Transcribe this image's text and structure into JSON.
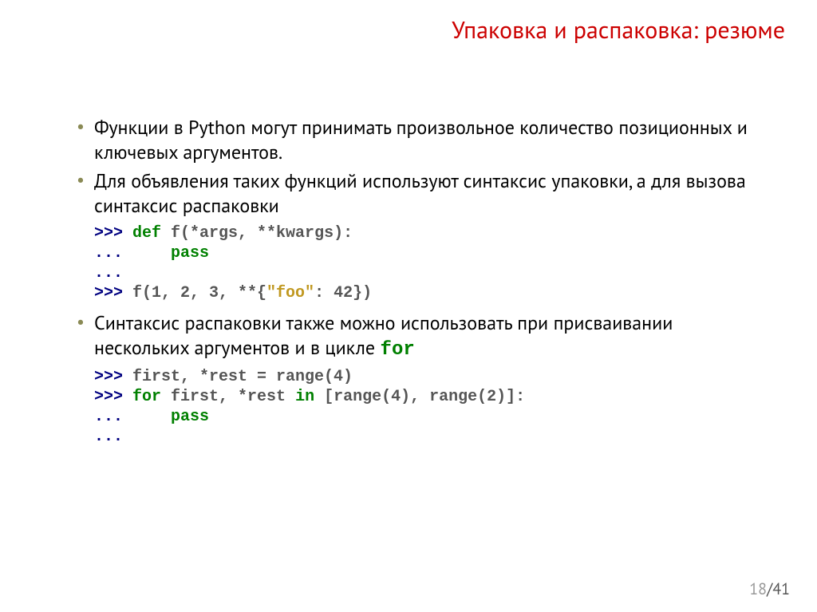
{
  "title": "Упаковка и распаковка: резюме",
  "bullets": {
    "b1": "Функции в Python могут принимать произвольное количество позиционных и ключевых аргументов.",
    "b2": "Для объявления таких функций используют синтаксис упаковки, а для вызова синтаксис распаковки",
    "b3_prefix": "Синтаксис распаковки также можно использовать при присваивании нескольких аргументов и в цикле ",
    "b3_code": "for"
  },
  "code1": {
    "l1_prompt": ">>> ",
    "l1_def": "def",
    "l1_rest": " f(*args, **kwargs):",
    "l2_prompt": "... ",
    "l2_indent": "    ",
    "l2_pass": "pass",
    "l3_prompt": "...",
    "l4_prompt": ">>> ",
    "l4_call_a": "f(1, 2, 3, **{",
    "l4_str": "\"foo\"",
    "l4_call_b": ": 42})"
  },
  "code2": {
    "l1_prompt": ">>> ",
    "l1_rest": "first, *rest = range(4)",
    "l2_prompt": ">>> ",
    "l2_for": "for",
    "l2_mid": " first, *rest ",
    "l2_in": "in",
    "l2_rest": " [range(4), range(2)]:",
    "l3_prompt": "... ",
    "l3_indent": "    ",
    "l3_pass": "pass",
    "l4_prompt": "..."
  },
  "page": {
    "current": "18",
    "sep": "/",
    "total": "41"
  }
}
